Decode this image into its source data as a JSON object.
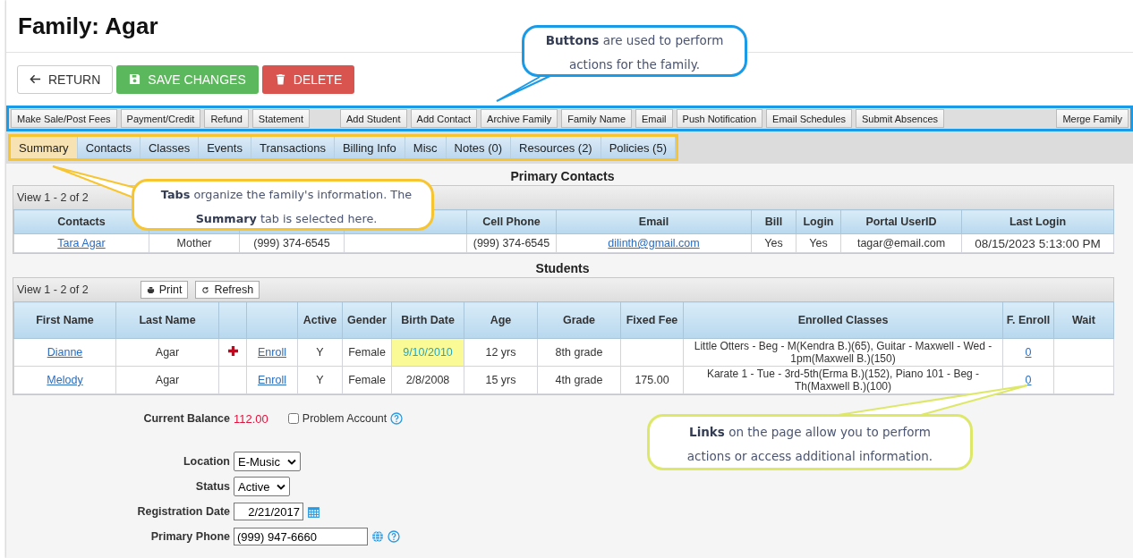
{
  "title": "Family: Agar",
  "action_buttons": [
    {
      "kind": "return",
      "label": "RETURN"
    },
    {
      "kind": "save",
      "label": "SAVE CHANGES"
    },
    {
      "kind": "delete",
      "label": "DELETE"
    }
  ],
  "toolbar_groups": [
    {
      "buttons": [
        "Make Sale/Post Fees",
        "Payment/Credit",
        "Refund",
        "Statement"
      ]
    },
    {
      "buttons": [
        "Add Student",
        "Add Contact",
        "Archive Family",
        "Family Name",
        "Email",
        "Push Notification",
        "Email Schedules",
        "Submit Absences"
      ]
    },
    {
      "buttons": [
        "Merge Family"
      ]
    }
  ],
  "tabs": [
    {
      "label": "Summary",
      "selected": true
    },
    {
      "label": "Contacts",
      "selected": false
    },
    {
      "label": "Classes",
      "selected": false
    },
    {
      "label": "Events",
      "selected": false
    },
    {
      "label": "Transactions",
      "selected": false
    },
    {
      "label": "Billing Info",
      "selected": false
    },
    {
      "label": "Misc",
      "selected": false
    },
    {
      "label": "Notes (0)",
      "selected": false
    },
    {
      "label": "Resources (2)",
      "selected": false
    },
    {
      "label": "Policies (5)",
      "selected": false
    }
  ],
  "primary_contacts": {
    "title": "Primary Contacts",
    "view_count": "View 1 - 2 of 2",
    "columns": [
      "Contacts",
      null,
      null,
      null,
      "Cell Phone",
      "Email",
      "Bill",
      "Login",
      "Portal UserID",
      "Last Login"
    ],
    "rows": [
      {
        "name": "Tara Agar",
        "relationship": "Mother",
        "phone": "(999) 374-6545",
        "cell_phone": "(999) 374-6545",
        "email": "dilinth@gmail.com",
        "bill": "Yes",
        "login": "Yes",
        "portal_userid": "tagar@email.com",
        "last_login": "08/15/2023 5:13:00 PM"
      }
    ]
  },
  "students": {
    "title": "Students",
    "view_count": "View 1 - 2 of 2",
    "print_label": "Print",
    "refresh_label": "Refresh",
    "columns": [
      "First Name",
      "Last Name",
      null,
      null,
      "Active",
      "Gender",
      "Birth Date",
      "Age",
      "Grade",
      "Fixed Fee",
      "Enrolled Classes",
      "F. Enroll",
      "Wait"
    ],
    "rows": [
      {
        "first_name": "Dianne",
        "last_name": "Agar",
        "medical_alert": true,
        "enroll": "Enroll",
        "active": "Y",
        "gender": "Female",
        "birth_date": "9/10/2010",
        "birthday_highlight": true,
        "age": "12 yrs",
        "grade": "8th grade",
        "enrolled_classes": "Little Otters - Beg - M(Kendra B.)(65), Guitar - Maxwell - Wed - 1pm(Maxwell B.)(150)",
        "f_enroll": "0"
      },
      {
        "first_name": "Melody",
        "last_name": "Agar",
        "medical_alert": false,
        "enroll": "Enroll",
        "active": "Y",
        "gender": "Female",
        "birth_date": "2/8/2008",
        "birthday_highlight": false,
        "age": "15 yrs",
        "grade": "4th grade",
        "fixed_fee": "175.00",
        "enrolled_classes": "Karate 1 - Tue - 3rd-5th(Erma B.)(152), Piano 101 - Beg - Th(Maxwell B.)(100)",
        "f_enroll": "0"
      }
    ]
  },
  "balance": {
    "label": "Current Balance",
    "value": "112.00"
  },
  "problem_account": {
    "label": "Problem Account",
    "checked": false
  },
  "fields": [
    {
      "kind": "select",
      "label": "Location",
      "value": "E-Music"
    },
    {
      "kind": "select",
      "label": "Status",
      "value": "Active"
    },
    {
      "kind": "date",
      "label": "Registration Date",
      "value": "2/21/2017"
    },
    {
      "kind": "phone",
      "label": "Primary Phone",
      "value": "(999) 947-6660"
    }
  ],
  "callouts": [
    {
      "kind": "buttons",
      "text": "**Buttons** are used to perform actions for the family.",
      "color": "#1a9be8"
    },
    {
      "kind": "tabs",
      "text": "**Tabs** organize the family's information. The **Summary** tab is selected here.",
      "color": "#f7c531"
    },
    {
      "kind": "links",
      "text": "**Links** on the page allow you to perform actions or access additional information.",
      "color": "#dde86a"
    }
  ]
}
